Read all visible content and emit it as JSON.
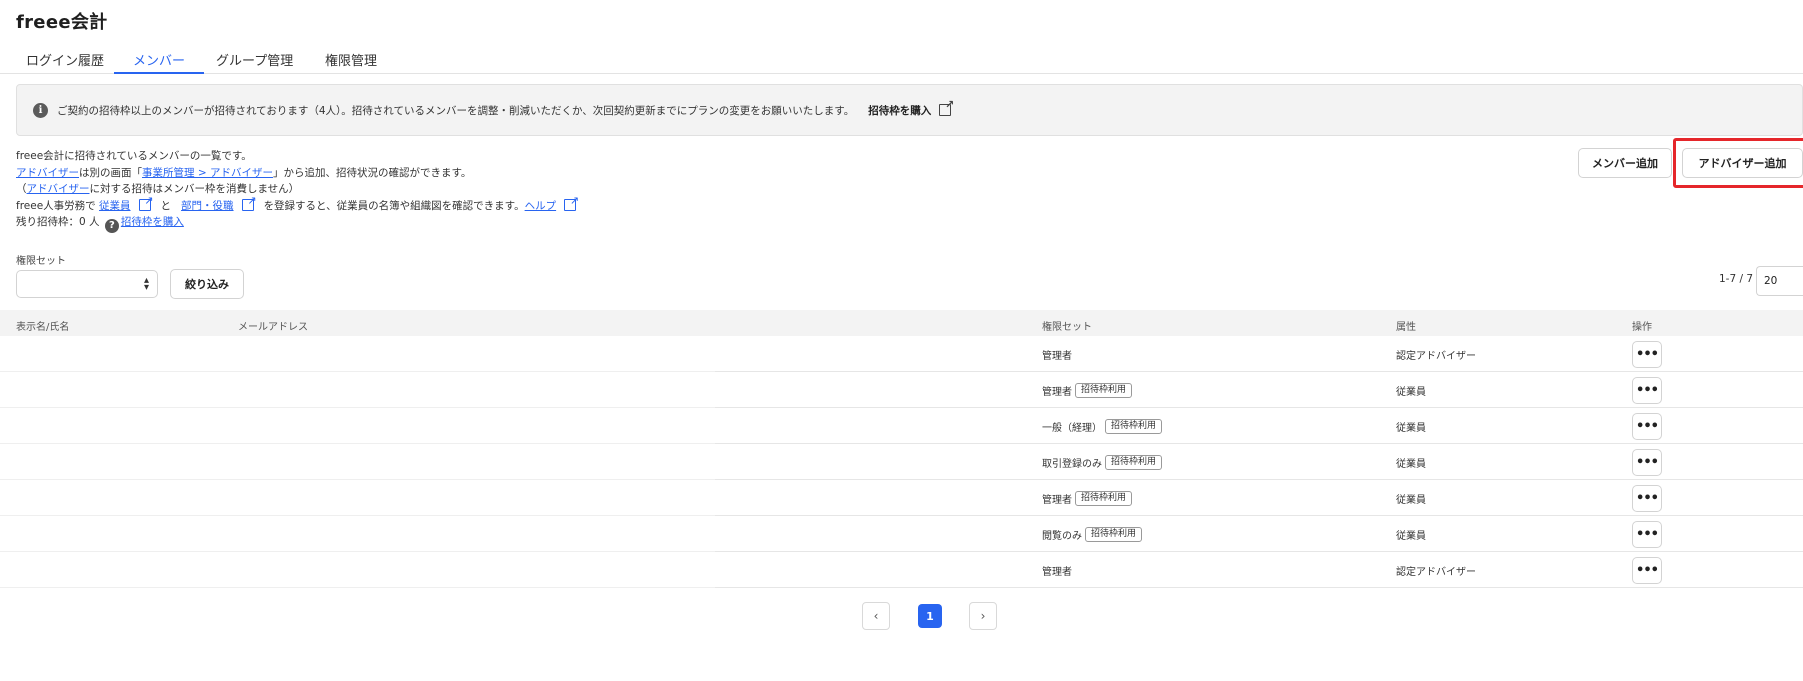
{
  "app": {
    "title": "freee会計"
  },
  "tabs": [
    {
      "label": "ログイン履歴",
      "active": false
    },
    {
      "label": "メンバー",
      "active": true
    },
    {
      "label": "グループ管理",
      "active": false
    },
    {
      "label": "権限管理",
      "active": false
    }
  ],
  "notice": {
    "icon": "info-icon",
    "text": "ご契約の招待枠以上のメンバーが招待されております（4人）。招待されているメンバーを調整・削減いただくか、次回契約更新までにプランの変更をお願いいたします。",
    "link": "招待枠を購入"
  },
  "description": {
    "line1": "freee会計に招待されているメンバーの一覧です。",
    "line2_link1": "アドバイザー",
    "line2_text1": "は別の画面「",
    "line2_link2": "事業所管理 > アドバイザー",
    "line2_text2": "」から追加、招待状況の確認ができます。",
    "line3_pre": "（",
    "line3_link": "アドバイザー",
    "line3_text": "に対する招待はメンバー枠を消費しません）",
    "line4_text1": "freee人事労務で",
    "line4_link1": "従業員",
    "line4_text2": "と",
    "line4_link2": "部門・役職",
    "line4_text3": "を登録すると、従業員の名簿や組織図を確認できます。",
    "line4_link3": "ヘルプ",
    "line5_text": "残り招待枠：0 人",
    "line5_link": "招待枠を購入"
  },
  "buttons": {
    "add_member": "メンバー追加",
    "add_advisor": "アドバイザー追加",
    "filter": "絞り込み"
  },
  "filter": {
    "label": "権限セット",
    "selected": ""
  },
  "pagination": {
    "range": "1-7 / 7",
    "per_page": "20",
    "current_page": "1",
    "prev": "‹",
    "next": "›"
  },
  "table": {
    "headers": [
      "表示名/氏名",
      "メールアドレス",
      "権限セット",
      "属性",
      "操作"
    ],
    "rows": [
      {
        "role": "管理者",
        "badge": "",
        "attribute": "認定アドバイザー"
      },
      {
        "role": "管理者",
        "badge": "招待枠利用",
        "attribute": "従業員"
      },
      {
        "role": "一般（経理）",
        "badge": "招待枠利用",
        "attribute": "従業員"
      },
      {
        "role": "取引登録のみ",
        "badge": "招待枠利用",
        "attribute": "従業員"
      },
      {
        "role": "管理者",
        "badge": "招待枠利用",
        "attribute": "従業員"
      },
      {
        "role": "閲覧のみ",
        "badge": "招待枠利用",
        "attribute": "従業員"
      },
      {
        "role": "管理者",
        "badge": "",
        "attribute": "認定アドバイザー"
      }
    ],
    "action_label": "•••"
  },
  "colors": {
    "accent": "#2864f0",
    "highlight": "#e5262a"
  }
}
